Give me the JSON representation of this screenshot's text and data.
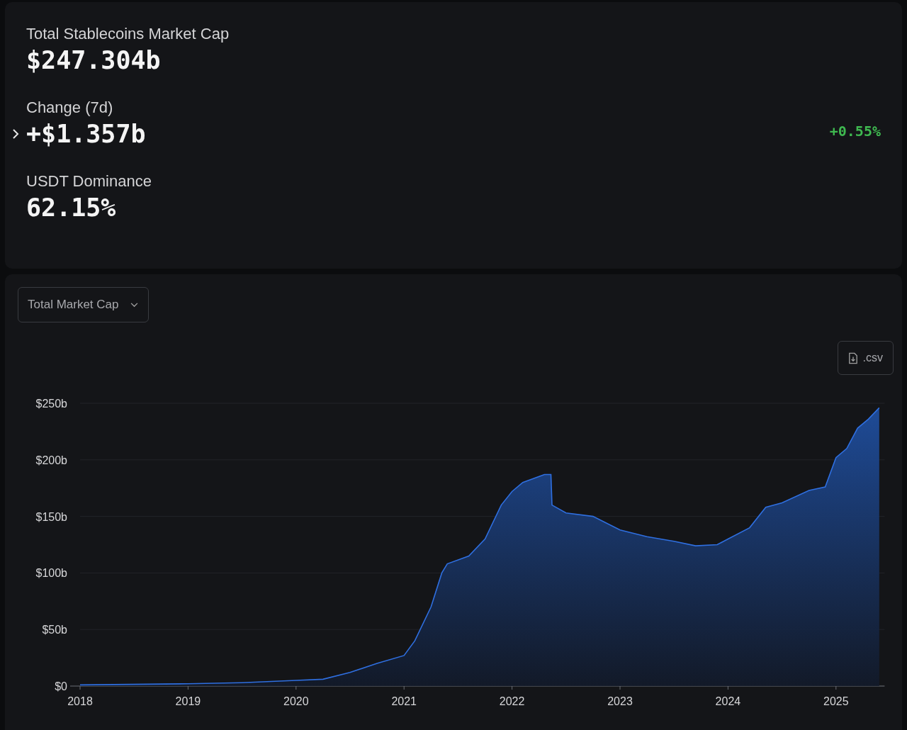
{
  "summary": {
    "stats": [
      {
        "label": "Total Stablecoins Market Cap",
        "value": "$247.304b",
        "expandable": false
      },
      {
        "label": "Change (7d)",
        "value": "+$1.357b",
        "expandable": true,
        "percent": "+0.55%",
        "color": "#3fb950"
      },
      {
        "label": "USDT Dominance",
        "value": "62.15%",
        "expandable": false
      }
    ]
  },
  "chart_panel": {
    "dropdown": {
      "label": "Total Market Cap"
    },
    "csv_button": {
      "label": ".csv"
    },
    "chart_data": {
      "type": "area",
      "x": [
        2018.0,
        2019.0,
        2019.5,
        2020.0,
        2020.25,
        2020.5,
        2020.75,
        2021.0,
        2021.1,
        2021.25,
        2021.35,
        2021.4,
        2021.6,
        2021.75,
        2021.9,
        2022.0,
        2022.1,
        2022.3,
        2022.36,
        2022.37,
        2022.5,
        2022.75,
        2023.0,
        2023.25,
        2023.5,
        2023.7,
        2023.9,
        2024.0,
        2024.2,
        2024.35,
        2024.5,
        2024.75,
        2024.9,
        2025.0,
        2025.1,
        2025.2,
        2025.3,
        2025.4
      ],
      "grid": true,
      "series": [
        {
          "color": "#2f6fe0",
          "values": [
            1,
            2,
            3,
            5,
            6,
            12,
            20,
            27,
            40,
            70,
            100,
            108,
            115,
            130,
            160,
            172,
            180,
            187,
            187,
            160,
            153,
            150,
            138,
            132,
            128,
            124,
            125,
            130,
            140,
            158,
            162,
            173,
            176,
            202,
            210,
            228,
            236,
            246
          ]
        }
      ],
      "xlim": [
        2018,
        2025.45
      ],
      "ylim": [
        0,
        250
      ],
      "xticks": [
        2018,
        2019,
        2020,
        2021,
        2022,
        2023,
        2024,
        2025
      ],
      "yticks": [
        {
          "value": 0,
          "label": "$0"
        },
        {
          "value": 50,
          "label": "$50b"
        },
        {
          "value": 100,
          "label": "$100b"
        },
        {
          "value": 150,
          "label": "$150b"
        },
        {
          "value": 200,
          "label": "$200b"
        },
        {
          "value": 250,
          "label": "$250b"
        }
      ]
    }
  }
}
